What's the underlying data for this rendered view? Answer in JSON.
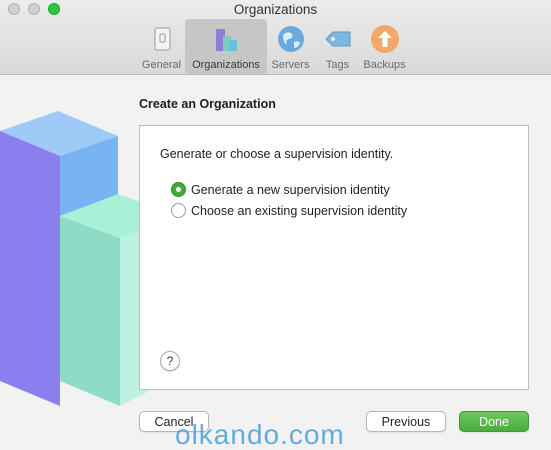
{
  "window": {
    "title": "Organizations"
  },
  "toolbar": {
    "tabs": [
      {
        "label": "General",
        "icon": "general-icon"
      },
      {
        "label": "Organizations",
        "icon": "organizations-icon",
        "active": true
      },
      {
        "label": "Servers",
        "icon": "globe-icon"
      },
      {
        "label": "Tags",
        "icon": "tag-icon"
      },
      {
        "label": "Backups",
        "icon": "backup-arrow-icon"
      }
    ]
  },
  "main": {
    "title": "Create an Organization",
    "prompt": "Generate or choose a supervision identity.",
    "options": [
      {
        "label": "Generate a new supervision identity",
        "checked": true
      },
      {
        "label": "Choose an existing supervision identity",
        "checked": false
      }
    ],
    "help_label": "?"
  },
  "buttons": {
    "cancel": "Cancel",
    "previous": "Previous",
    "done": "Done"
  },
  "watermark": "olkando.com",
  "colors": {
    "accent_green": "#48ad3f",
    "radio_selected": "#3faa3a",
    "backup_orange": "#f3a86a",
    "tag_blue": "#7fb7dd",
    "watermark_blue": "#4aa2d8"
  }
}
